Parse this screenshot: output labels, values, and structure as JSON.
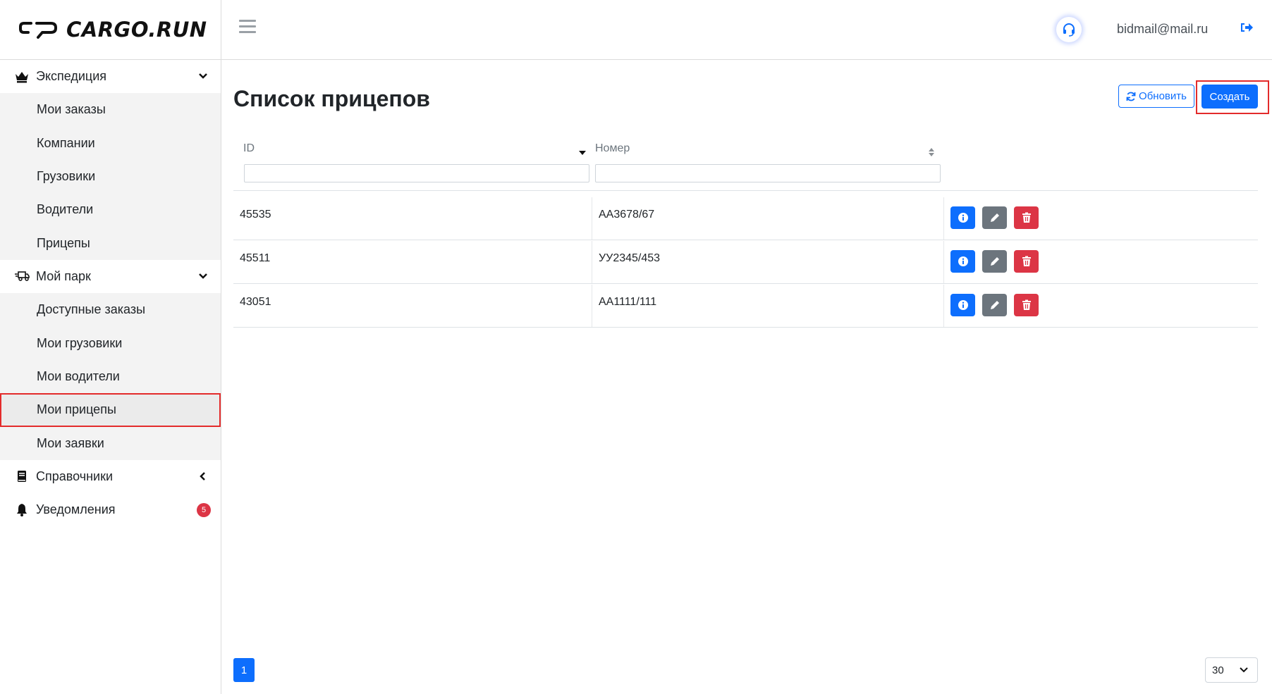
{
  "app": {
    "logo_text": "CARGO.RUN"
  },
  "header": {
    "user_email": "bidmail@mail.ru"
  },
  "sidebar": {
    "groups": [
      {
        "label": "Экспедиция",
        "icon": "crown-icon",
        "expanded": true,
        "items": [
          "Мои заказы",
          "Компании",
          "Грузовики",
          "Водители",
          "Прицепы"
        ]
      },
      {
        "label": "Мой парк",
        "icon": "truck-icon",
        "expanded": true,
        "items": [
          "Доступные заказы",
          "Мои грузовики",
          "Мои водители",
          "Мои прицепы",
          "Мои заявки"
        ],
        "active_item": "Мои прицепы"
      },
      {
        "label": "Справочники",
        "icon": "book-icon",
        "expanded": false
      },
      {
        "label": "Уведомления",
        "icon": "bell-icon",
        "badge": "5"
      }
    ]
  },
  "main": {
    "title": "Список прицепов",
    "refresh_label": "Обновить",
    "create_label": "Создать",
    "columns": [
      "ID",
      "Номер"
    ],
    "rows": [
      {
        "id": "45535",
        "number": "АА3678/67"
      },
      {
        "id": "45511",
        "number": "УУ2345/453"
      },
      {
        "id": "43051",
        "number": "АА1111/111"
      }
    ],
    "pagination": {
      "current_page": "1",
      "page_size": "30"
    }
  },
  "colors": {
    "primary": "#0d6efd",
    "secondary": "#6c757d",
    "danger": "#dc3545",
    "highlight": "#e32b2b"
  }
}
